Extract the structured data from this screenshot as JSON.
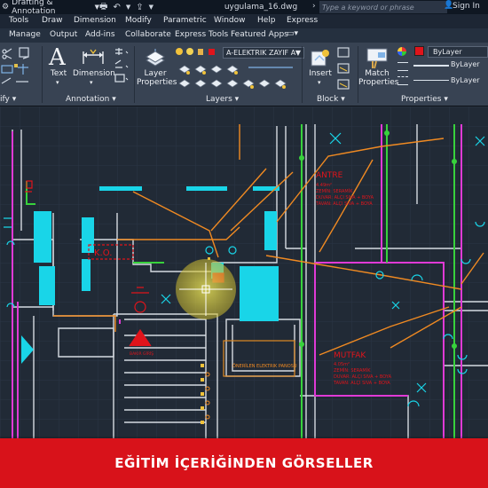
{
  "titlebar": {
    "workspace": "Drafting & Annotation",
    "filename": "uygulama_16.dwg",
    "search_placeholder": "Type a keyword or phrase",
    "sign_in": "Sign In"
  },
  "menu": [
    "Tools",
    "Draw",
    "Dimension",
    "Modify",
    "Parametric",
    "Window",
    "Help",
    "Express"
  ],
  "tabs": [
    "Manage",
    "Output",
    "Add-ins",
    "Collaborate",
    "Express Tools",
    "Featured Apps"
  ],
  "ribbon": {
    "text_label": "Text",
    "dimension_label": "Dimension",
    "annotation_title": "Annotation",
    "layer_properties_label": "Layer Properties",
    "layer_name": "A-ELEKTRIK ZAYIF A",
    "layers_title": "Layers",
    "insert_label": "Insert",
    "block_title": "Block",
    "match_properties_label": "Match Properties",
    "color_value": "ByLayer",
    "linetype_value": "ByLayer",
    "lineweight_value": "ByLayer",
    "properties_title": "Properties",
    "modify_title": "ify"
  },
  "drawing": {
    "room1_name": "ANTRE",
    "room1_area": "4.49m²",
    "room1_lines": [
      "ZEMİN: SERAMİK",
      "DUVAR: ALÇI SIVA + BOYA",
      "TAVAN: ALÇI SIVA + BOYA"
    ],
    "room2_name": "MUTFAK",
    "room2_area": "4.05m²",
    "room2_lines": [
      "ZEMİN: SERAMİK",
      "DUVAR: ALÇI SIVA + BOYA",
      "TAVAN: ALÇI SIVA + BOYA"
    ],
    "ko_label": "K.O.",
    "stair_label": "BAKIR GİRİŞ",
    "ogen_label": "ÖNERİLEN ELEKTRIK PANOSU"
  },
  "banner": {
    "text": "EĞİTİM İÇERİĞİNDEN GÖRSELLER"
  },
  "colors": {
    "banner": "#d8121a",
    "canvas": "#212a36",
    "ribbon": "#384353",
    "layer_swatch": "#e0141b"
  }
}
